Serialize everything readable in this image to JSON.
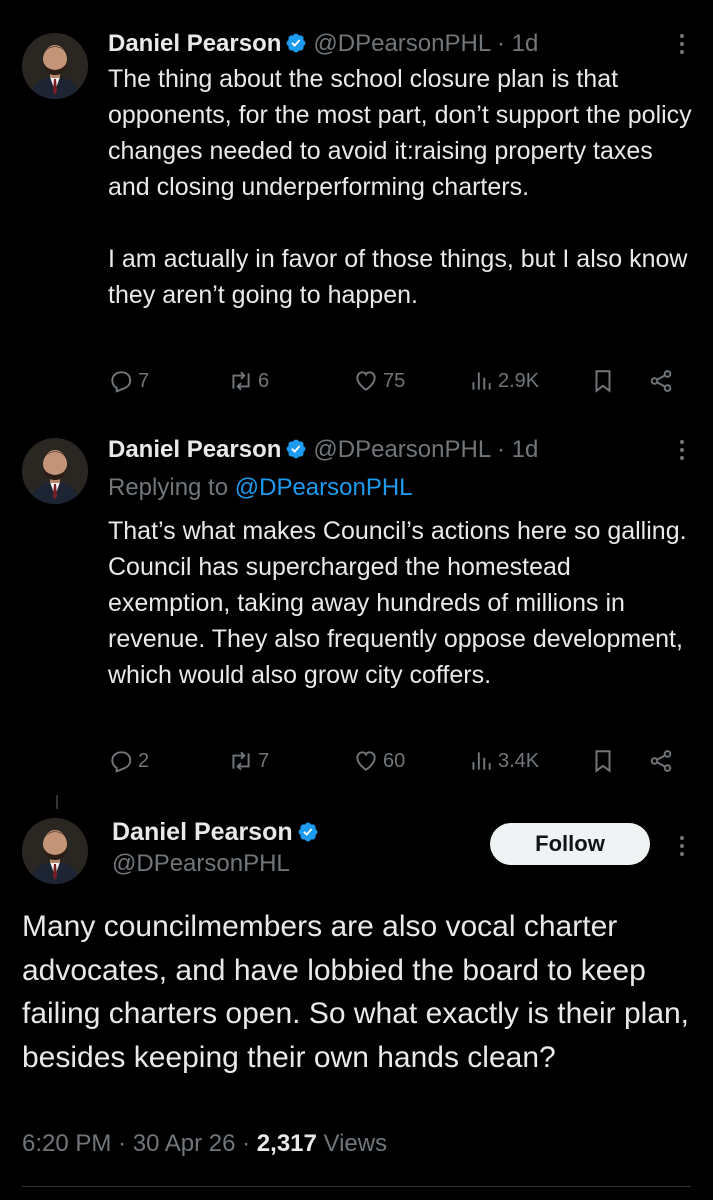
{
  "colors": {
    "background": "#000000",
    "text": "#e7e9ea",
    "muted": "#71767b",
    "link": "#1d9bf0",
    "verified": "#1d9bf0"
  },
  "tweets": [
    {
      "name": "Daniel Pearson",
      "handle": "@DPearsonPHL",
      "separator": "·",
      "time": "1d",
      "text": "The thing about the school closure plan is that opponents, for the most part, don’t support the policy changes needed to avoid it:raising property taxes and closing underperforming charters.\n\nI am actually in favor of those things, but I also know they aren’t going to happen.",
      "replies": "7",
      "reposts": "6",
      "likes": "75",
      "views": "2.9K"
    },
    {
      "name": "Daniel Pearson",
      "handle": "@DPearsonPHL",
      "separator": "·",
      "time": "1d",
      "replying_prefix": "Replying to ",
      "replying_to": "@DPearsonPHL",
      "text": "That’s what makes Council’s actions here so galling. Council has supercharged the homestead exemption, taking away hundreds of millions in revenue. They also frequently oppose development, which would also grow city coffers.",
      "replies": "2",
      "reposts": "7",
      "likes": "60",
      "views": "3.4K"
    }
  ],
  "main_tweet": {
    "name": "Daniel Pearson",
    "handle": "@DPearsonPHL",
    "follow_label": "Follow",
    "text": "Many councilmembers are also vocal charter advocates, and have lobbied the board to keep failing charters open. So what exactly is their plan, besides keeping their own hands clean?",
    "time": "6:20 PM",
    "sep1": " · ",
    "date": "30 Apr 26",
    "sep2": " · ",
    "views_count": "2,317",
    "views_label": " Views"
  }
}
